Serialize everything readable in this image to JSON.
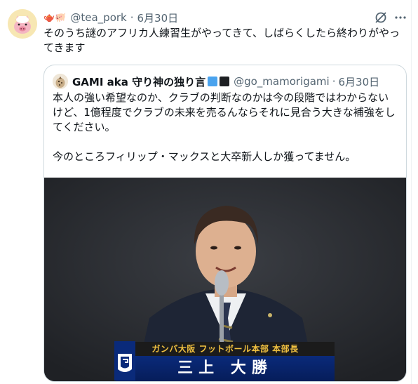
{
  "tweet": {
    "emoji": "🫖🐖",
    "handle": "@tea_pork",
    "separator": "·",
    "date": "6月30日",
    "text": "そのうち謎のアフリカ人練習生がやってきて、しばらくしたら終わりがやってきます"
  },
  "quote": {
    "display_name": "GAMI aka 守り神の独り言",
    "handle": "@go_mamorigami",
    "separator": "·",
    "date": "6月30日",
    "paragraph1": "本人の強い希望なのか、クラブの判断なのかは今の段階ではわからないけど、1億程度でクラブの未来を売るんならそれに見合う大きな補強をしてください。",
    "paragraph2": "今のところフィリップ・マックスと大卒新人しか獲ってません。",
    "media": {
      "caption_org": "ガンバ大阪 フットボール本部 本部長",
      "caption_name": "三上 大勝"
    }
  },
  "icons": {
    "avatar": "pig-avatar-icon",
    "grok": "grok-icon",
    "more": "more-icon",
    "badge1": "blue-square-badge",
    "badge2": "black-square-badge",
    "logo": "gamba-osaka-logo-icon"
  },
  "colors": {
    "muted_text": "#536471",
    "border": "#cfd9de",
    "badge_blue": "#4aa3ee",
    "badge_black": "#1d1f23",
    "caption_gold": "#f0c040",
    "caption_navy": "#0a2a7a"
  }
}
